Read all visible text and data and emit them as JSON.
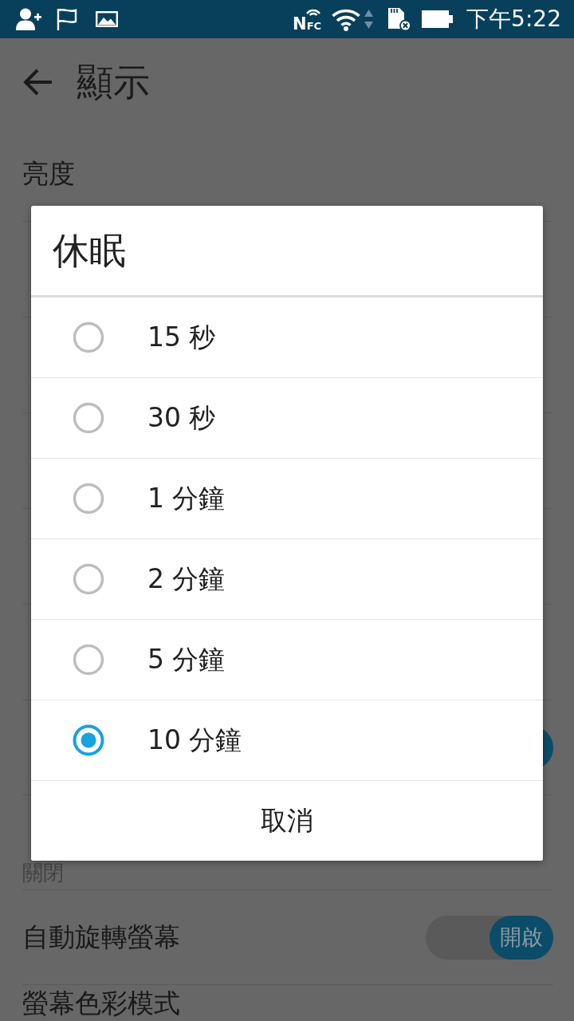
{
  "status_bar": {
    "nfc": "NFC",
    "time": "下午5:22"
  },
  "screen": {
    "title": "顯示",
    "top_items": [
      {
        "title": "亮度"
      }
    ],
    "bottom_items": [
      {
        "toggle": {
          "on": true
        }
      },
      {
        "subtitle": "關閉"
      },
      {
        "title": "自動旋轉螢幕",
        "toggle": {
          "on": true,
          "label": "開啟"
        }
      },
      {
        "title": "螢幕色彩模式"
      }
    ]
  },
  "dialog": {
    "title": "休眠",
    "options": [
      {
        "label": "15 秒",
        "selected": false
      },
      {
        "label": "30 秒",
        "selected": false
      },
      {
        "label": "1 分鐘",
        "selected": false
      },
      {
        "label": "2 分鐘",
        "selected": false
      },
      {
        "label": "5 分鐘",
        "selected": false
      },
      {
        "label": "10 分鐘",
        "selected": true
      }
    ],
    "buttons": [
      "取消"
    ]
  }
}
